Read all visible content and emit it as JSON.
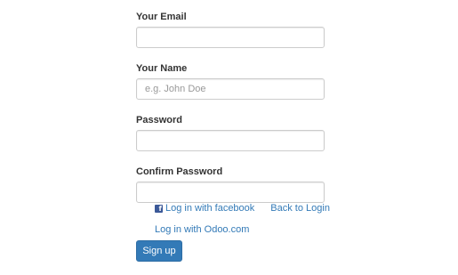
{
  "form": {
    "email": {
      "label": "Your Email",
      "value": "",
      "placeholder": ""
    },
    "name": {
      "label": "Your Name",
      "value": "",
      "placeholder": "e.g. John Doe"
    },
    "password": {
      "label": "Password",
      "value": "",
      "placeholder": ""
    },
    "confirm_password": {
      "label": "Confirm Password",
      "value": "",
      "placeholder": ""
    }
  },
  "links": {
    "facebook": {
      "icon": "facebook-icon",
      "label": "Log in with facebook"
    },
    "back_to_login": "Back to Login",
    "odoo": "Log in with Odoo.com"
  },
  "actions": {
    "signup_label": "Sign up"
  },
  "colors": {
    "link": "#337ab7",
    "primary_button": "#337ab7",
    "facebook": "#3b5998"
  }
}
